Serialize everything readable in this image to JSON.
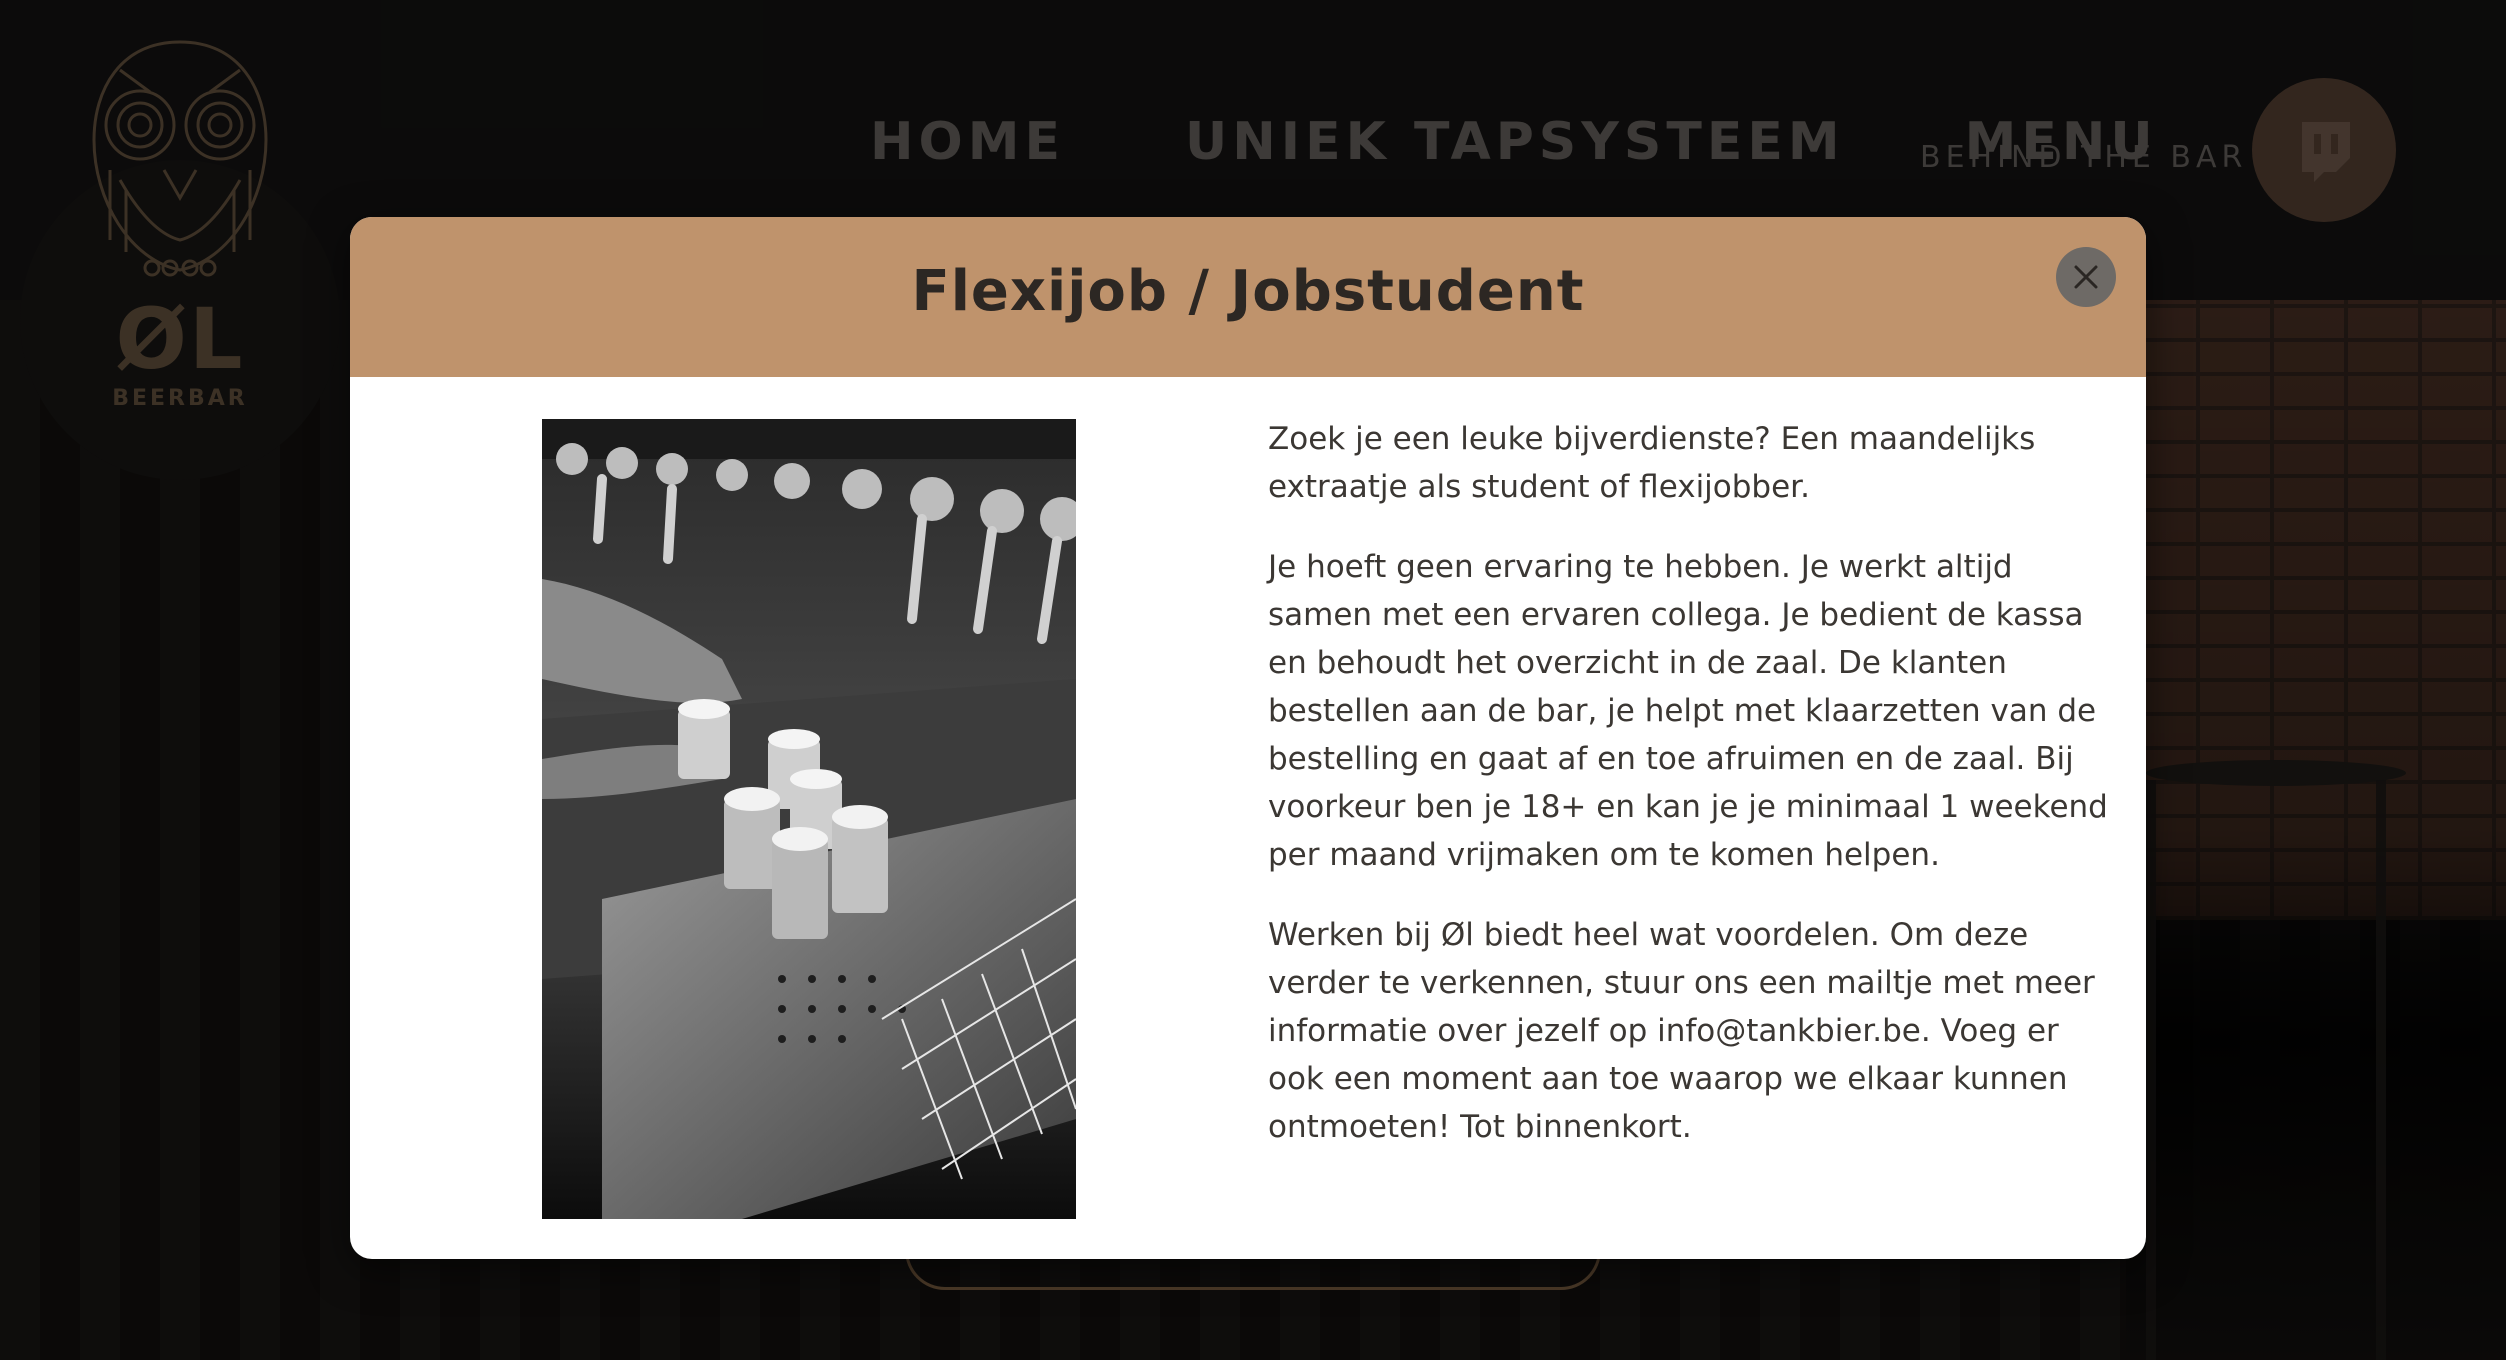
{
  "header": {
    "logo": {
      "brand": "ØL",
      "subtitle": "BEERBAR"
    },
    "nav": {
      "home": "HOME",
      "tapsysteem": "UNIEK TAPSYSTEEM",
      "menu": "MENU"
    },
    "behind_the_bar": "BEHIND THE BAR",
    "twitch_icon": "twitch-icon"
  },
  "modal": {
    "title": "Flexijob / Jobstudent",
    "close_icon": "close-icon",
    "photo_description_icon": "beer-tap-photo",
    "paragraphs": [
      "Zoek je een leuke bijverdienste? Een maandelijks extraatje als student of flexijobber.",
      "Je hoeft geen ervaring te hebben. Je werkt altijd samen met een ervaren collega. Je bedient de kassa en behoudt het overzicht in de zaal. De klanten bestellen aan de bar, je helpt met klaarzetten van de bestelling en gaat af en toe afruimen en de zaal. Bij voorkeur ben je 18+ en kan je je minimaal 1 weekend per maand vrijmaken om te komen helpen.",
      "Werken bij Øl biedt heel wat voordelen. Om deze verder te verkennen, stuur ons een mailtje met meer informatie over jezelf op info@tankbier.be. Voeg er ook een moment aan toe waarop we elkaar kunnen ontmoeten! Tot binnenkort."
    ]
  },
  "colors": {
    "modal_header": "#bf936c",
    "accent_brown": "#6e5a44",
    "twitch_bg": "#5d4638",
    "nav_text": "#6f6b66"
  }
}
